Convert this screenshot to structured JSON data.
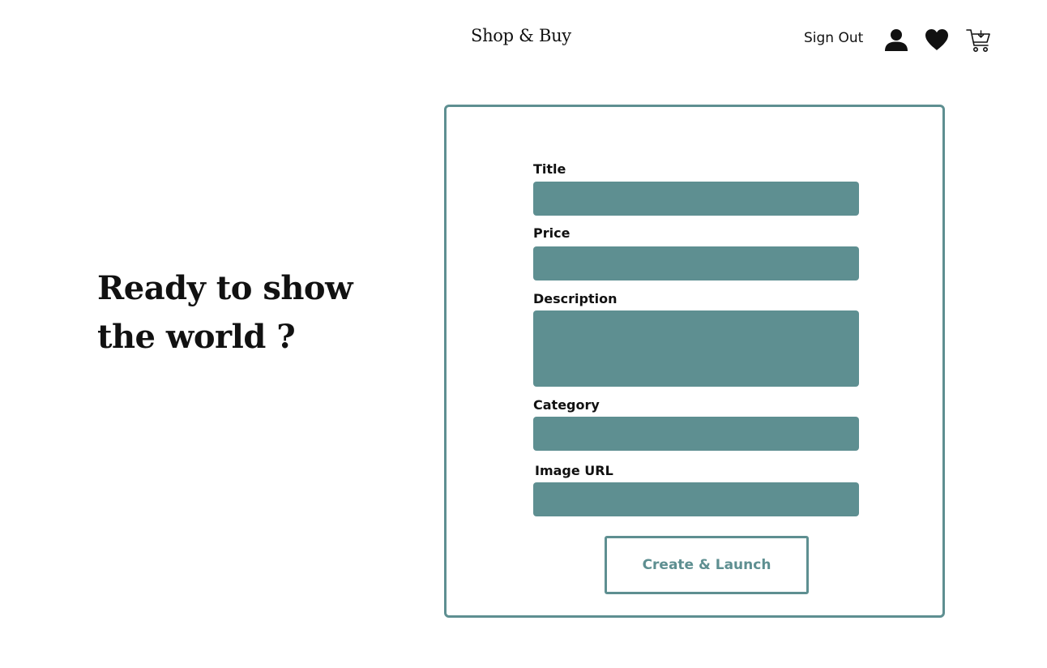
{
  "header": {
    "brand": "Shop & Buy",
    "sign_out_label": "Sign Out",
    "icons": [
      "user-icon",
      "heart-icon",
      "cart-icon"
    ]
  },
  "hero": {
    "line1": "Ready to show",
    "line2": "the world ?"
  },
  "form": {
    "fields": [
      {
        "label": "Title",
        "value": "",
        "placeholder": ""
      },
      {
        "label": "Price",
        "value": "",
        "placeholder": ""
      },
      {
        "label": "Description",
        "value": "",
        "placeholder": ""
      },
      {
        "label": "Category",
        "value": "",
        "placeholder": ""
      },
      {
        "label": "Image URL",
        "value": "",
        "placeholder": ""
      }
    ],
    "submit_label": "Create & Launch"
  },
  "colors": {
    "accent": "#5e8f91",
    "background": "#ffffff",
    "text": "#111111"
  }
}
